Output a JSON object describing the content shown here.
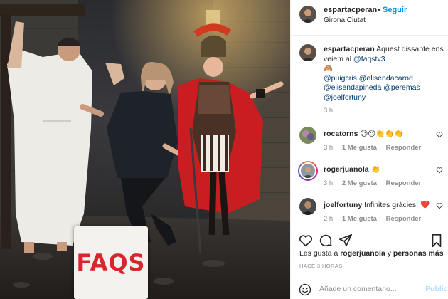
{
  "post": {
    "photo_sign_text": "FAQS"
  },
  "header": {
    "username": "espartacperan",
    "separator": "•",
    "follow_label": "Seguir",
    "location": "Girona Ciutat"
  },
  "caption": {
    "username": "espartacperan",
    "text": "Aquest dissabte ens veiem al",
    "mention_main": "@faqstv3",
    "emoji": "🙈",
    "tags_line1": "@puigcris @elisendacarod",
    "tags_line2": "@elisendapineda @peremas",
    "tags_line3": "@joelfortuny",
    "time": "3 h"
  },
  "comments": [
    {
      "username": "rocatorns",
      "text": "😍😍👏👏👏",
      "time": "3 h",
      "likes": "1 Me gusta",
      "reply": "Responder"
    },
    {
      "username": "rogerjuanola",
      "text": "👏",
      "time": "3 h",
      "likes": "2 Me gusta",
      "reply": "Responder"
    },
    {
      "username": "joelfortuny",
      "text": "Infinites gràcies! ❤️",
      "time": "2 h",
      "likes": "1 Me gusta",
      "reply": "Responder"
    }
  ],
  "likes_line": {
    "prefix": "Les gusta a",
    "user": "rogerjuanola",
    "joiner": "y",
    "others": "personas más"
  },
  "posted_time": "HACE 3 HORAS",
  "add_comment": {
    "placeholder": "Añade un comentario...",
    "publish_label": "Publicar"
  },
  "icons": {
    "like": "heart-icon",
    "comment": "comment-icon",
    "share": "share-icon",
    "save": "bookmark-icon",
    "emoji": "emoji-icon"
  },
  "colors": {
    "link": "#0095f6",
    "mention": "#00376b",
    "muted": "#8e8e8e",
    "faqs_red": "#d7262d"
  }
}
